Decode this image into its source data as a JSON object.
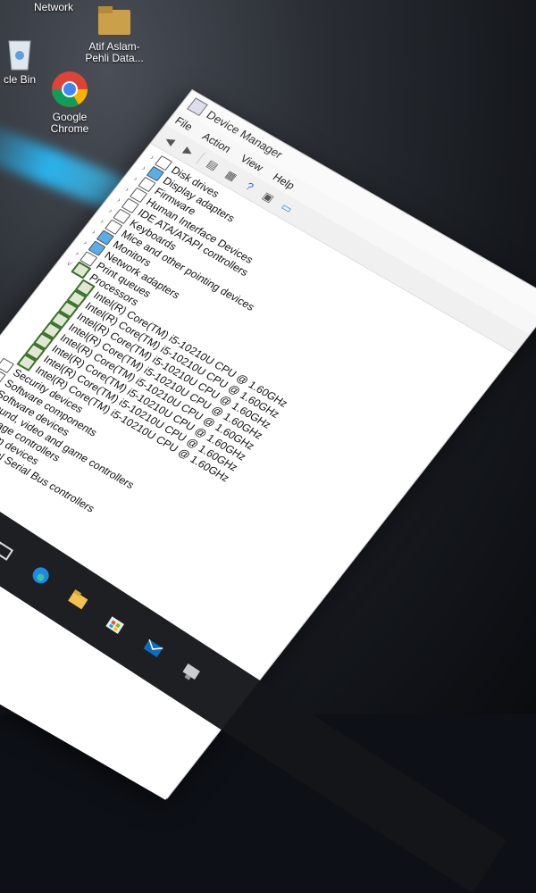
{
  "desktop": {
    "icons": [
      {
        "label": "Network"
      },
      {
        "label": "Atif Aslam- Pehli Data..."
      },
      {
        "label": "cle Bin"
      },
      {
        "label": "Google Chrome"
      }
    ]
  },
  "device_manager": {
    "title": "Device Manager",
    "menu": [
      "File",
      "Action",
      "View",
      "Help"
    ],
    "tree": [
      {
        "label": "Disk drives",
        "expanded": false
      },
      {
        "label": "Display adapters",
        "expanded": false
      },
      {
        "label": "Firmware",
        "expanded": false
      },
      {
        "label": "Human Interface Devices",
        "expanded": false
      },
      {
        "label": "IDE ATA/ATAPI controllers",
        "expanded": false
      },
      {
        "label": "Keyboards",
        "expanded": false
      },
      {
        "label": "Mice and other pointing devices",
        "expanded": false
      },
      {
        "label": "Monitors",
        "expanded": false
      },
      {
        "label": "Network adapters",
        "expanded": false
      },
      {
        "label": "Print queues",
        "expanded": false
      },
      {
        "label": "Processors",
        "expanded": true
      },
      {
        "label": "Intel(R) Core(TM) i5-10210U CPU @ 1.60GHz",
        "child": true
      },
      {
        "label": "Intel(R) Core(TM) i5-10210U CPU @ 1.60GHz",
        "child": true
      },
      {
        "label": "Intel(R) Core(TM) i5-10210U CPU @ 1.60GHz",
        "child": true
      },
      {
        "label": "Intel(R) Core(TM) i5-10210U CPU @ 1.60GHz",
        "child": true
      },
      {
        "label": "Intel(R) Core(TM) i5-10210U CPU @ 1.60GHz",
        "child": true
      },
      {
        "label": "Intel(R) Core(TM) i5-10210U CPU @ 1.60GHz",
        "child": true
      },
      {
        "label": "Intel(R) Core(TM) i5-10210U CPU @ 1.60GHz",
        "child": true
      },
      {
        "label": "Intel(R) Core(TM) i5-10210U CPU @ 1.60GHz",
        "child": true
      },
      {
        "label": "Security devices",
        "expanded": false
      },
      {
        "label": "Software components",
        "expanded": false
      },
      {
        "label": "Software devices",
        "expanded": false
      },
      {
        "label": "Sound, video and game controllers",
        "expanded": false
      },
      {
        "label": "Storage controllers",
        "expanded": false
      },
      {
        "label": "System devices",
        "expanded": false
      },
      {
        "label": "Universal Serial Bus controllers",
        "expanded": false
      }
    ]
  },
  "colors": {
    "accent": "#2bbcff",
    "window_bg": "#ffffff",
    "processor_icon": "#3a6f2a"
  }
}
